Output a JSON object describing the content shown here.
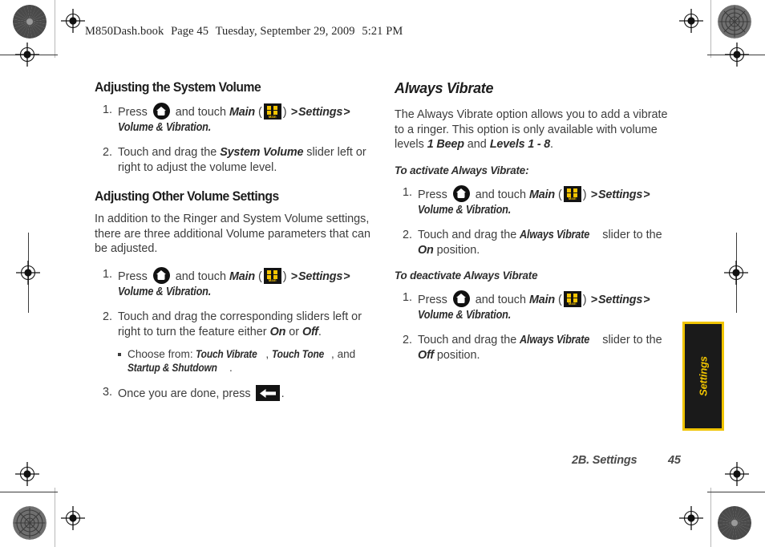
{
  "running_header": {
    "file": "M850Dash.book",
    "page_label": "Page 45",
    "date": "Tuesday, September 29, 2009",
    "time": "5:21 PM"
  },
  "left_column": {
    "section1": {
      "heading": "Adjusting the System Volume",
      "steps": [
        {
          "num": "1.",
          "part_a": "Press",
          "part_b": "and touch",
          "italic_main": "Main",
          "paren_open": "(",
          "paren_close": ")",
          "chevron1": ">",
          "italic_settings": "Settings",
          "chevron2": ">",
          "italic_volume": "Volume & Vibration."
        },
        {
          "num": "2.",
          "text_a": "Touch and drag the",
          "italic_a": "System Volume",
          "text_b": "slider left or right to adjust the volume level."
        }
      ]
    },
    "section2": {
      "heading": "Adjusting Other Volume Settings",
      "intro": "In addition to the Ringer and System Volume settings, there are three additional Volume parameters that can be adjusted.",
      "steps": [
        {
          "num": "1.",
          "part_a": "Press",
          "part_b": "and touch",
          "italic_main": "Main",
          "paren_open": "(",
          "paren_close": ")",
          "chevron1": ">",
          "italic_settings": "Settings",
          "chevron2": ">",
          "italic_volume": "Volume & Vibration."
        },
        {
          "num": "2.",
          "text_a": "Touch and drag the corresponding sliders left or right to turn the feature either",
          "italic_on": "On",
          "text_or": "or",
          "italic_off": "Off",
          "period": ".",
          "sub_bullet": {
            "prefix": "Choose from:",
            "item1": "Touch Vibrate",
            "comma1": ",",
            "item2": "Touch Tone",
            "comma2": ",",
            "and": "and",
            "item3": "Startup & Shutdown",
            "period": "."
          }
        },
        {
          "num": "3.",
          "text_a": "Once you are done, press",
          "period": "."
        }
      ]
    }
  },
  "right_column": {
    "heading": "Always Vibrate",
    "intro_a": "The Always Vibrate option allows you to add a vibrate to a ringer. This option is only available with volume levels",
    "intro_italic1": "1 Beep",
    "intro_and": "and",
    "intro_italic2": "Levels 1 - 8",
    "intro_period": ".",
    "activate_lead": "To activate Always Vibrate:",
    "activate_steps": [
      {
        "num": "1.",
        "part_a": "Press",
        "part_b": "and touch",
        "italic_main": "Main",
        "paren_open": "(",
        "paren_close": ")",
        "chevron1": ">",
        "italic_settings": "Settings",
        "chevron2": ">",
        "italic_volume": "Volume & Vibration."
      },
      {
        "num": "2.",
        "text_a": "Touch and drag the",
        "italic_a": "Always Vibrate",
        "text_b": "slider to the",
        "italic_b": "On",
        "text_c": "position."
      }
    ],
    "deactivate_lead": "To deactivate Always Vibrate",
    "deactivate_steps": [
      {
        "num": "1.",
        "part_a": "Press",
        "part_b": "and touch",
        "italic_main": "Main",
        "paren_open": "(",
        "paren_close": ")",
        "chevron1": ">",
        "italic_settings": "Settings",
        "chevron2": ">",
        "italic_volume": "Volume & Vibration."
      },
      {
        "num": "2.",
        "text_a": "Touch and drag the",
        "italic_a": "Always Vibrate",
        "text_b": "slider to the",
        "italic_b": "Off",
        "text_c": "position."
      }
    ]
  },
  "thumb_tab": {
    "label": "Settings"
  },
  "footer": {
    "chapter": "2B. Settings",
    "page_number": "45"
  },
  "icons": {
    "home": "home-icon",
    "main_menu": "main-menu-icon",
    "main_menu_label": "Main",
    "back_arrow": "back-arrow-icon"
  },
  "colors": {
    "tab_accent": "#f0c400",
    "icon_yellow": "#f5c400",
    "icon_black": "#131313",
    "text": "#3d3d3d"
  }
}
